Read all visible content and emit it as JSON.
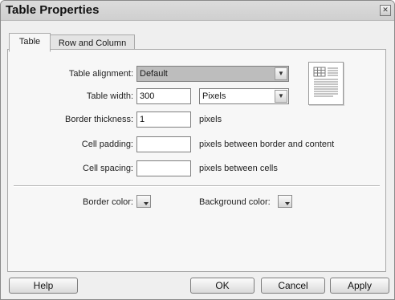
{
  "window": {
    "title": "Table Properties",
    "close_glyph": "✕"
  },
  "tabs": [
    {
      "label": "Table",
      "active": true
    },
    {
      "label": "Row and Column",
      "active": false
    }
  ],
  "form": {
    "alignment_label": "Table alignment:",
    "alignment_value": "Default",
    "width_label": "Table width:",
    "width_value": "300",
    "width_unit": "Pixels",
    "border_label": "Border thickness:",
    "border_value": "1",
    "border_unit": "pixels",
    "padding_label": "Cell padding:",
    "padding_value": "",
    "padding_hint": "pixels between border and content",
    "spacing_label": "Cell spacing:",
    "spacing_value": "",
    "spacing_hint": "pixels between cells",
    "border_color_label": "Border color:",
    "background_color_label": "Background color:"
  },
  "buttons": {
    "help": "Help",
    "ok": "OK",
    "cancel": "Cancel",
    "apply": "Apply"
  },
  "icons": {
    "close": "close-icon",
    "dropdown": "chevron-down-icon",
    "preview": "table-preview-icon"
  },
  "colors": {
    "dialog_bg": "#efefef",
    "panel_bg": "#f7f7f7",
    "select_shaded": "#bdbdbd"
  }
}
